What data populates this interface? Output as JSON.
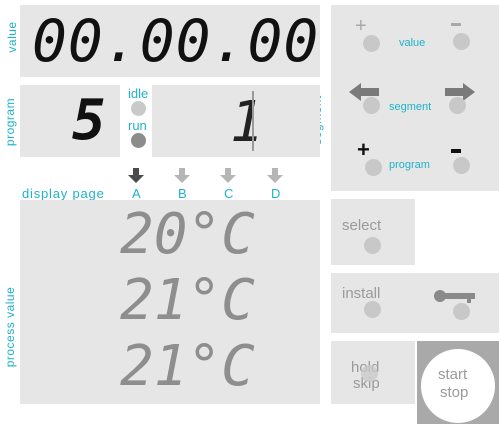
{
  "side_labels": {
    "value": "value",
    "program": "program",
    "segment": "segment",
    "process_value": "process value"
  },
  "value_display": "00.00.00",
  "program_display": "5",
  "segment_display": "1",
  "status": {
    "idle": "idle",
    "run": "run"
  },
  "display_page": {
    "label": "display page",
    "pages": [
      "A",
      "B",
      "C",
      "D"
    ]
  },
  "process_values": [
    "20°C",
    "21°C",
    "21°C"
  ],
  "controls": {
    "value_label": "value",
    "value_plus": "+",
    "value_minus": "−",
    "segment_label": "segment",
    "program_label": "program",
    "program_plus": "+",
    "program_minus": "−",
    "select_label": "select",
    "install_label": "install",
    "hold_label": "hold",
    "skip_label": "skip",
    "start_label": "start",
    "stop_label": "stop"
  },
  "colors": {
    "accent": "#1fb3c9",
    "panel": "#e6e6e6",
    "segment_dark": "#111111",
    "segment_dim": "#8e8e8e"
  },
  "icons": [
    "arrow-left-icon",
    "arrow-right-icon",
    "key-icon",
    "arrow-down-icon"
  ]
}
